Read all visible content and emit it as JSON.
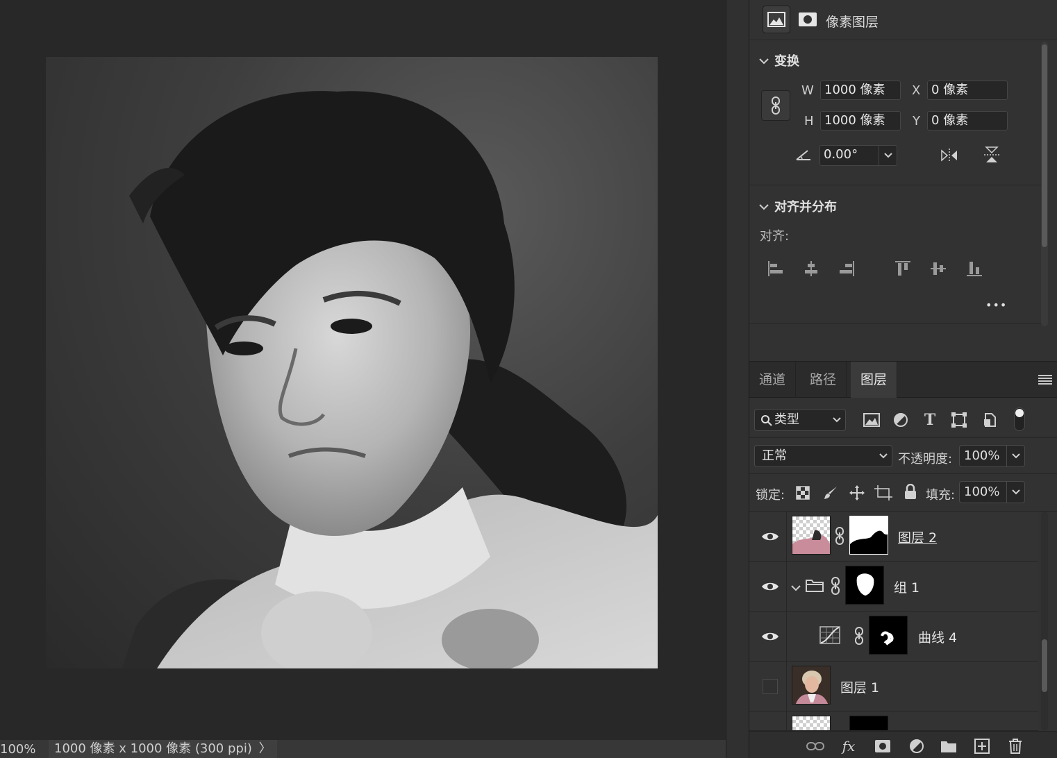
{
  "status": {
    "zoom": "100%",
    "doc_size": "1000 像素 x 1000 像素 (300 ppi)",
    "arrow": "〉"
  },
  "properties": {
    "layer_type": "像素图层",
    "transform": {
      "title": "变换",
      "w_label": "W",
      "w_value": "1000 像素",
      "h_label": "H",
      "h_value": "1000 像素",
      "x_label": "X",
      "x_value": "0 像素",
      "y_label": "Y",
      "y_value": "0 像素",
      "angle_value": "0.00°"
    },
    "align": {
      "title": "对齐并分布",
      "label": "对齐:",
      "more": "•••"
    }
  },
  "layers_panel": {
    "tabs": [
      {
        "label": "通道"
      },
      {
        "label": "路径"
      },
      {
        "label": "图层"
      }
    ],
    "active_tab": "图层",
    "filter_kind": "类型",
    "blend_mode": "正常",
    "opacity_label": "不透明度:",
    "opacity_value": "100%",
    "lock_label": "锁定:",
    "fill_label": "填充:",
    "fill_value": "100%",
    "layers": [
      {
        "name": "图层 2",
        "visible": true
      },
      {
        "name": "组 1",
        "visible": true
      },
      {
        "name": "曲线 4",
        "visible": true
      },
      {
        "name": "图层 1",
        "visible": false
      }
    ]
  },
  "colors": {
    "canvas_bg": "#282828",
    "panel_bg": "#323232",
    "active_tab": "#3b3b3b"
  }
}
